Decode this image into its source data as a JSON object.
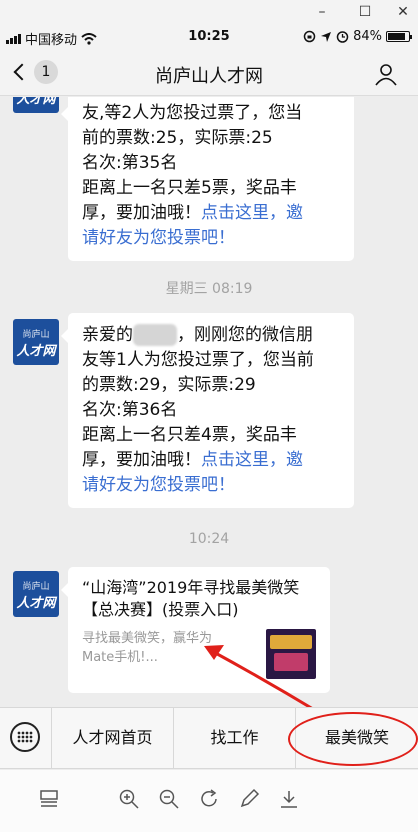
{
  "window": {
    "minimize": "–",
    "maximize": "☐",
    "close": "✕"
  },
  "status": {
    "carrier": "中国移动",
    "time": "10:25",
    "battery": "84%",
    "battery_level": 0.84
  },
  "nav": {
    "back_count": "1",
    "title": "尚庐山人才网"
  },
  "avatar": {
    "top": "尚庐山",
    "bottom": "人才网"
  },
  "messages": [
    {
      "lines": [
        "友,等2人为您投过票了，您当",
        "前的票数:25，实际票:25",
        "名次:第35名",
        "距离上一名只差5票，奖品丰"
      ],
      "tail": "厚，要加油哦！",
      "link_a": "点击这里，邀",
      "link_b": "请好友为您投票吧！"
    },
    {
      "greet": "亲爱的",
      "greet_rest": "，刚刚您的微信朋",
      "lines": [
        "友等1人为您投过票了，您当前",
        "的票数:29，实际票:29",
        "名次:第36名",
        "距离上一名只差4票，奖品丰"
      ],
      "tail": "厚，要加油哦！",
      "link_a": "点击这里，邀",
      "link_b": "请好友为您投票吧！"
    }
  ],
  "timestamps": {
    "t1": "星期三 08:19",
    "t2": "10:24"
  },
  "card": {
    "title": "“山海湾”2019年寻找最美微笑【总决赛】(投票入口)",
    "desc": "寻找最美微笑，赢华为Mate手机!..."
  },
  "menu": {
    "item1": "人才网首页",
    "item2": "找工作",
    "item3": "最美微笑"
  },
  "tools": [
    "layout-icon",
    "zoom-in-icon",
    "zoom-out-icon",
    "rotate-icon",
    "pen-icon",
    "download-icon"
  ]
}
